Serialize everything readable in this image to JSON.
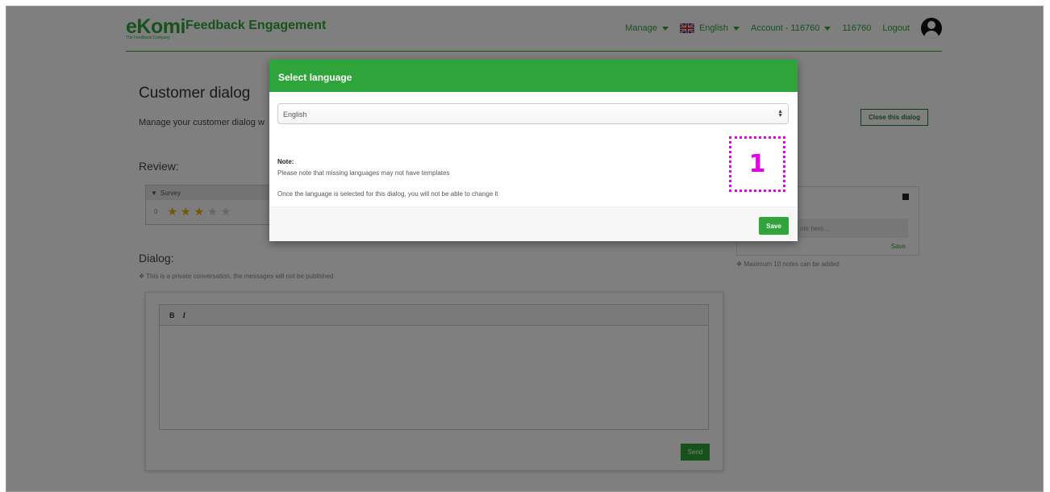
{
  "header": {
    "logo_text": "eKomi",
    "logo_sub": "The Feedback Company",
    "app_title": "Feedback Engagement",
    "nav": {
      "manage": "Manage",
      "language": "English",
      "account": "Account - 116760",
      "account_id": "116760",
      "logout": "Logout"
    }
  },
  "page": {
    "title": "Customer dialog",
    "description": "Manage your customer dialog w",
    "close_dialog": "Close this dialog",
    "review_heading": "Review:",
    "survey_label": "Survey",
    "survey_number": "0",
    "rating": 3,
    "rating_max": 5,
    "notes_placeholder": "ote here...",
    "notes_save": "Save",
    "notes_hint": "Maximum 10 notes can be added",
    "dialog_heading": "Dialog:",
    "dialog_note": "This is a private conversation, the messages will not be published",
    "toolbar_bold": "B",
    "toolbar_italic": "I",
    "send": "Send"
  },
  "modal": {
    "title": "Select language",
    "selected_language": "English",
    "note_title": "Note:",
    "note_line1": "Please note that missing languages may not have templates",
    "note_line2": "Once the language is selected for this dialog, you will not be able to change it",
    "marker": "1",
    "save": "Save"
  },
  "colors": {
    "brand_green": "#2ea43a",
    "overlay": "rgba(0,0,0,0.5)",
    "marker": "#e600e6"
  }
}
